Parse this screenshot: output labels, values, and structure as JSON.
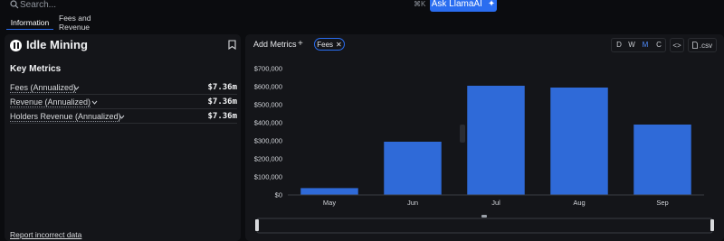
{
  "search": {
    "placeholder": "Search...",
    "shortcut": "⌘K"
  },
  "ask_button": {
    "label": "Ask LlamaAI"
  },
  "tabs": [
    {
      "label": "Information",
      "active": true
    },
    {
      "label": "Fees and Revenue",
      "active": false
    }
  ],
  "protocol": {
    "name": "Idle Mining",
    "icon": "idle-mining-logo"
  },
  "key_metrics": {
    "title": "Key Metrics",
    "rows": [
      {
        "label": "Fees (Annualized)",
        "value": "$7.36m"
      },
      {
        "label": "Revenue (Annualized)",
        "value": "$7.36m"
      },
      {
        "label": "Holders Revenue (Annualized)",
        "value": "$7.36m"
      }
    ]
  },
  "report_link": "Report incorrect data",
  "chart_toolbar": {
    "add_metrics": "Add Metrics",
    "add_icon": "+",
    "metric_chip": "Fees",
    "chip_close": "✕",
    "periods": [
      "D",
      "W",
      "M",
      "C"
    ],
    "active_period": "M",
    "embed_label": "<>",
    "csv_label": ".csv"
  },
  "colors": {
    "accent": "#2a6df0",
    "bar": "#2f6ad8",
    "background": "#0b0c0f",
    "panel": "#141519"
  },
  "chart_data": {
    "type": "bar",
    "categories": [
      "May",
      "Jun",
      "Jul",
      "Aug",
      "Sep"
    ],
    "series": [
      {
        "name": "Fees",
        "values": [
          38000,
          295000,
          605000,
          595000,
          390000
        ]
      }
    ],
    "ylim": [
      0,
      700000
    ],
    "yticks": [
      "$0",
      "$100,000",
      "$200,000",
      "$300,000",
      "$400,000",
      "$500,000",
      "$600,000",
      "$700,000"
    ],
    "grid": false,
    "legend": "none"
  }
}
